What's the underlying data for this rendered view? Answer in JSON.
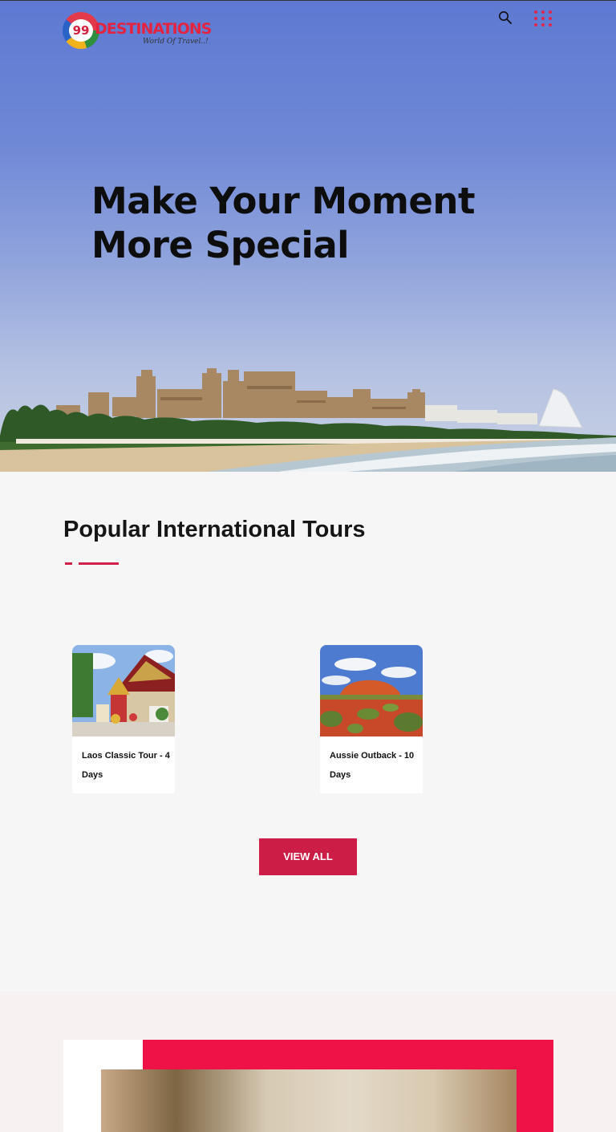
{
  "header": {
    "logo_number": "99",
    "logo_text": "DESTINATIONS",
    "logo_tagline": "World Of Travel..!",
    "icons": [
      "search-icon",
      "grid-menu-icon"
    ]
  },
  "hero": {
    "title_line1": "Make Your Moment",
    "title_line2": "More Special"
  },
  "tours": {
    "heading": "Popular International Tours",
    "items": [
      {
        "title": "Laos Classic Tour - 4 Days"
      },
      {
        "title": "Aussie Outback - 10 Days"
      }
    ],
    "view_all_label": "VIEW ALL"
  },
  "colors": {
    "accent": "#cc1d47",
    "accent_bright": "#ee1246",
    "sky_top": "#5d79d2",
    "background": "#f6f6f6"
  }
}
